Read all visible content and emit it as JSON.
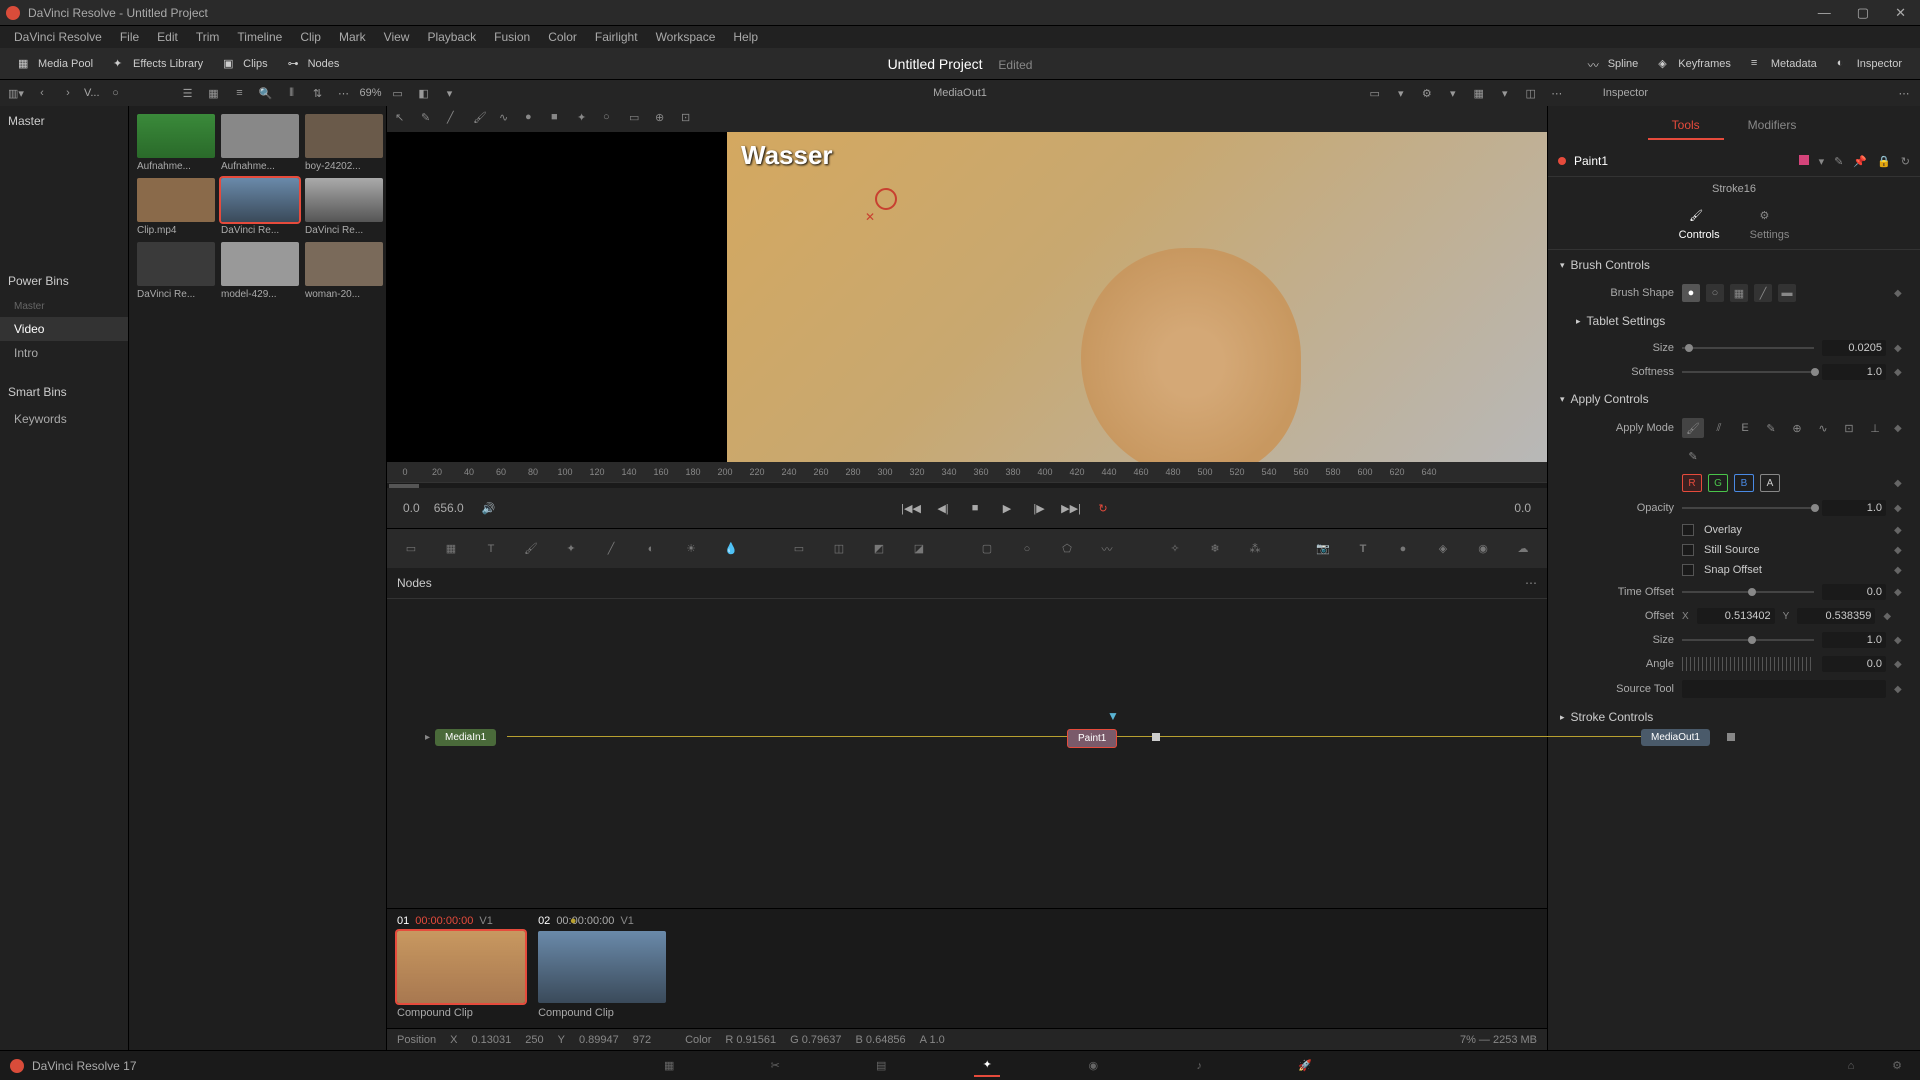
{
  "titlebar": {
    "text": "DaVinci Resolve - Untitled Project"
  },
  "menu": [
    "DaVinci Resolve",
    "File",
    "Edit",
    "Trim",
    "Timeline",
    "Clip",
    "Mark",
    "View",
    "Playback",
    "Fusion",
    "Color",
    "Fairlight",
    "Workspace",
    "Help"
  ],
  "toolbar": {
    "media_pool": "Media Pool",
    "effects_library": "Effects Library",
    "clips": "Clips",
    "nodes": "Nodes",
    "project_title": "Untitled Project",
    "edited": "Edited",
    "spline": "Spline",
    "keyframes": "Keyframes",
    "metadata": "Metadata",
    "inspector": "Inspector"
  },
  "sub_toolbar": {
    "v_label": "V...",
    "zoom": "69%",
    "viewer_name": "MediaOut1",
    "inspector_label": "Inspector"
  },
  "left_panel": {
    "master": "Master",
    "power_bins": "Power Bins",
    "items": [
      "Master",
      "Video",
      "Intro"
    ],
    "smart_bins": "Smart Bins",
    "keywords": "Keywords"
  },
  "media": {
    "thumbs": [
      {
        "label": "Aufnahme..."
      },
      {
        "label": "Aufnahme..."
      },
      {
        "label": "boy-24202..."
      },
      {
        "label": "Clip.mp4"
      },
      {
        "label": "DaVinci Re...",
        "selected": true
      },
      {
        "label": "DaVinci Re..."
      },
      {
        "label": "DaVinci Re..."
      },
      {
        "label": "model-429..."
      },
      {
        "label": "woman-20..."
      }
    ]
  },
  "viewer": {
    "watermark": "Wasser",
    "ruler_start": 0,
    "ruler_ticks": [
      "0",
      "20",
      "40",
      "60",
      "80",
      "100",
      "120",
      "140",
      "160",
      "180",
      "200",
      "220",
      "240",
      "260",
      "280",
      "300",
      "320",
      "340",
      "360",
      "380",
      "400",
      "420",
      "440",
      "460",
      "480",
      "500",
      "520",
      "540",
      "560",
      "580",
      "600",
      "620",
      "640"
    ]
  },
  "transport": {
    "time_in": "0.0",
    "time_dur": "656.0",
    "time_out": "0.0"
  },
  "nodes_panel": {
    "title": "Nodes",
    "medialn": "MediaIn1",
    "paint": "Paint1",
    "mediaout": "MediaOut1"
  },
  "clips": [
    {
      "num": "01",
      "tc": "00:00:00:00",
      "track": "V1",
      "label": "Compound Clip",
      "selected": true,
      "tc_red": true
    },
    {
      "num": "02",
      "tc": "00:00:00:00",
      "track": "V1",
      "label": "Compound Clip"
    }
  ],
  "inspector": {
    "tabs": {
      "tools": "Tools",
      "modifiers": "Modifiers"
    },
    "node_name": "Paint1",
    "stroke": "Stroke16",
    "sub_tabs": {
      "controls": "Controls",
      "settings": "Settings"
    },
    "sections": {
      "brush_controls": "Brush Controls",
      "brush_shape": "Brush Shape",
      "tablet_settings": "Tablet Settings",
      "size_label": "Size",
      "size_val": "0.0205",
      "softness_label": "Softness",
      "softness_val": "1.0",
      "apply_controls": "Apply Controls",
      "apply_mode": "Apply Mode",
      "channels": {
        "r": "R",
        "g": "G",
        "b": "B",
        "a": "A"
      },
      "opacity_label": "Opacity",
      "opacity_val": "1.0",
      "overlay": "Overlay",
      "still_source": "Still Source",
      "snap_offset": "Snap Offset",
      "time_offset_label": "Time Offset",
      "time_offset_val": "0.0",
      "offset_label": "Offset",
      "offset_x_lbl": "X",
      "offset_x": "0.513402",
      "offset_y_lbl": "Y",
      "offset_y": "0.538359",
      "size2_label": "Size",
      "size2_val": "1.0",
      "angle_label": "Angle",
      "angle_val": "0.0",
      "source_tool": "Source Tool",
      "stroke_controls": "Stroke Controls"
    }
  },
  "status": {
    "pos_label": "Position",
    "x_lbl": "X",
    "x": "0.13031",
    "x_px": "250",
    "y_lbl": "Y",
    "y": "0.89947",
    "y_px": "972",
    "color_label": "Color",
    "r": "R 0.91561",
    "g": "G 0.79637",
    "b": "B 0.64856",
    "a": "A 1.0",
    "mem": "7% — 2253 MB"
  },
  "bottombar": {
    "version": "DaVinci Resolve 17"
  }
}
